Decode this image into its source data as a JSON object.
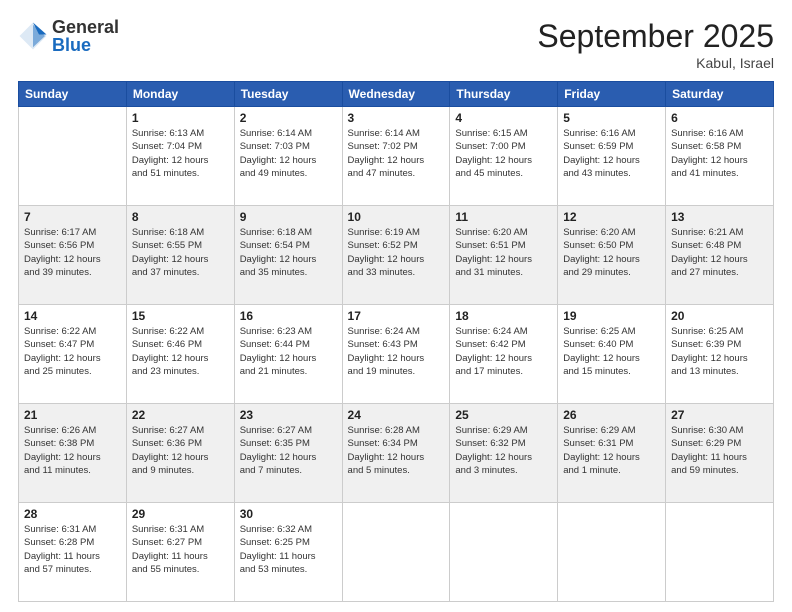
{
  "logo": {
    "general": "General",
    "blue": "Blue"
  },
  "header": {
    "month": "September 2025",
    "location": "Kabul, Israel"
  },
  "weekdays": [
    "Sunday",
    "Monday",
    "Tuesday",
    "Wednesday",
    "Thursday",
    "Friday",
    "Saturday"
  ],
  "weeks": [
    [
      {
        "day": "",
        "info": ""
      },
      {
        "day": "1",
        "info": "Sunrise: 6:13 AM\nSunset: 7:04 PM\nDaylight: 12 hours\nand 51 minutes."
      },
      {
        "day": "2",
        "info": "Sunrise: 6:14 AM\nSunset: 7:03 PM\nDaylight: 12 hours\nand 49 minutes."
      },
      {
        "day": "3",
        "info": "Sunrise: 6:14 AM\nSunset: 7:02 PM\nDaylight: 12 hours\nand 47 minutes."
      },
      {
        "day": "4",
        "info": "Sunrise: 6:15 AM\nSunset: 7:00 PM\nDaylight: 12 hours\nand 45 minutes."
      },
      {
        "day": "5",
        "info": "Sunrise: 6:16 AM\nSunset: 6:59 PM\nDaylight: 12 hours\nand 43 minutes."
      },
      {
        "day": "6",
        "info": "Sunrise: 6:16 AM\nSunset: 6:58 PM\nDaylight: 12 hours\nand 41 minutes."
      }
    ],
    [
      {
        "day": "7",
        "info": "Sunrise: 6:17 AM\nSunset: 6:56 PM\nDaylight: 12 hours\nand 39 minutes."
      },
      {
        "day": "8",
        "info": "Sunrise: 6:18 AM\nSunset: 6:55 PM\nDaylight: 12 hours\nand 37 minutes."
      },
      {
        "day": "9",
        "info": "Sunrise: 6:18 AM\nSunset: 6:54 PM\nDaylight: 12 hours\nand 35 minutes."
      },
      {
        "day": "10",
        "info": "Sunrise: 6:19 AM\nSunset: 6:52 PM\nDaylight: 12 hours\nand 33 minutes."
      },
      {
        "day": "11",
        "info": "Sunrise: 6:20 AM\nSunset: 6:51 PM\nDaylight: 12 hours\nand 31 minutes."
      },
      {
        "day": "12",
        "info": "Sunrise: 6:20 AM\nSunset: 6:50 PM\nDaylight: 12 hours\nand 29 minutes."
      },
      {
        "day": "13",
        "info": "Sunrise: 6:21 AM\nSunset: 6:48 PM\nDaylight: 12 hours\nand 27 minutes."
      }
    ],
    [
      {
        "day": "14",
        "info": "Sunrise: 6:22 AM\nSunset: 6:47 PM\nDaylight: 12 hours\nand 25 minutes."
      },
      {
        "day": "15",
        "info": "Sunrise: 6:22 AM\nSunset: 6:46 PM\nDaylight: 12 hours\nand 23 minutes."
      },
      {
        "day": "16",
        "info": "Sunrise: 6:23 AM\nSunset: 6:44 PM\nDaylight: 12 hours\nand 21 minutes."
      },
      {
        "day": "17",
        "info": "Sunrise: 6:24 AM\nSunset: 6:43 PM\nDaylight: 12 hours\nand 19 minutes."
      },
      {
        "day": "18",
        "info": "Sunrise: 6:24 AM\nSunset: 6:42 PM\nDaylight: 12 hours\nand 17 minutes."
      },
      {
        "day": "19",
        "info": "Sunrise: 6:25 AM\nSunset: 6:40 PM\nDaylight: 12 hours\nand 15 minutes."
      },
      {
        "day": "20",
        "info": "Sunrise: 6:25 AM\nSunset: 6:39 PM\nDaylight: 12 hours\nand 13 minutes."
      }
    ],
    [
      {
        "day": "21",
        "info": "Sunrise: 6:26 AM\nSunset: 6:38 PM\nDaylight: 12 hours\nand 11 minutes."
      },
      {
        "day": "22",
        "info": "Sunrise: 6:27 AM\nSunset: 6:36 PM\nDaylight: 12 hours\nand 9 minutes."
      },
      {
        "day": "23",
        "info": "Sunrise: 6:27 AM\nSunset: 6:35 PM\nDaylight: 12 hours\nand 7 minutes."
      },
      {
        "day": "24",
        "info": "Sunrise: 6:28 AM\nSunset: 6:34 PM\nDaylight: 12 hours\nand 5 minutes."
      },
      {
        "day": "25",
        "info": "Sunrise: 6:29 AM\nSunset: 6:32 PM\nDaylight: 12 hours\nand 3 minutes."
      },
      {
        "day": "26",
        "info": "Sunrise: 6:29 AM\nSunset: 6:31 PM\nDaylight: 12 hours\nand 1 minute."
      },
      {
        "day": "27",
        "info": "Sunrise: 6:30 AM\nSunset: 6:29 PM\nDaylight: 11 hours\nand 59 minutes."
      }
    ],
    [
      {
        "day": "28",
        "info": "Sunrise: 6:31 AM\nSunset: 6:28 PM\nDaylight: 11 hours\nand 57 minutes."
      },
      {
        "day": "29",
        "info": "Sunrise: 6:31 AM\nSunset: 6:27 PM\nDaylight: 11 hours\nand 55 minutes."
      },
      {
        "day": "30",
        "info": "Sunrise: 6:32 AM\nSunset: 6:25 PM\nDaylight: 11 hours\nand 53 minutes."
      },
      {
        "day": "",
        "info": ""
      },
      {
        "day": "",
        "info": ""
      },
      {
        "day": "",
        "info": ""
      },
      {
        "day": "",
        "info": ""
      }
    ]
  ]
}
